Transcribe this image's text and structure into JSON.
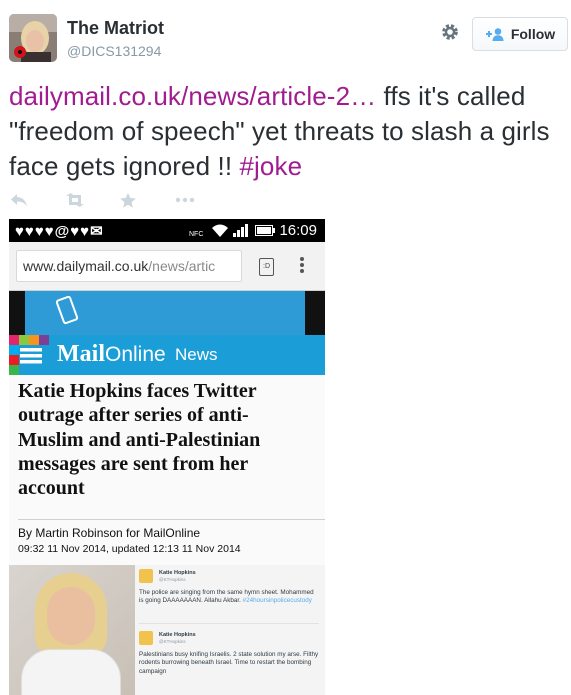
{
  "user": {
    "display_name": "The Matriot",
    "screen_name": "@DICS131294"
  },
  "follow_button": {
    "label": "Follow"
  },
  "tweet": {
    "link": "dailymail.co.uk/news/article-2…",
    "text": " ffs it's called \"freedom of speech\" yet threats to slash a girls face gets ignored !! ",
    "hashtag": "#joke"
  },
  "actions": [
    {
      "icon": "reply-icon"
    },
    {
      "icon": "retweet-icon"
    },
    {
      "icon": "favorite-icon"
    },
    {
      "icon": "more-icon"
    }
  ],
  "screenshot": {
    "status_icons": "♥♥♥♥@♥♥✉",
    "status_nfc": "NFC",
    "status_time": "16:09",
    "url_host": "www.dailymail.co.uk",
    "url_rest": "/news/artic",
    "tab_label": ":D",
    "brand": "Mail",
    "brand_suffix": "Online",
    "section": "News",
    "headline": "Katie Hopkins faces Twitter outrage after series of anti-Muslim and anti-Palestinian messages are sent from her account",
    "byline": "By Martin Robinson for MailOnline",
    "dateline": "09:32 11 Nov 2014, updated 12:13 11 Nov 2014",
    "embedded_tweets": [
      {
        "name": "Katie Hopkins",
        "handle": "@KTHopkins",
        "text": "The police are singing from the same hymn sheet. Mohammed is going DAAAAAAAN. Allahu Akbar.",
        "tag": "#24hoursinpolicecustody"
      },
      {
        "name": "Katie Hopkins",
        "handle": "@KTHopkins",
        "text": "Palestinians busy knifing Israelis. 2 state solution my arse. Filthy rodents burrowing beneath Israel. Time to restart the bombing campaign",
        "tag": ""
      }
    ]
  },
  "colors": {
    "link": "#a01c8f",
    "mail_blue": "#1b9ed8",
    "action_gray": "#ccd6dd"
  }
}
